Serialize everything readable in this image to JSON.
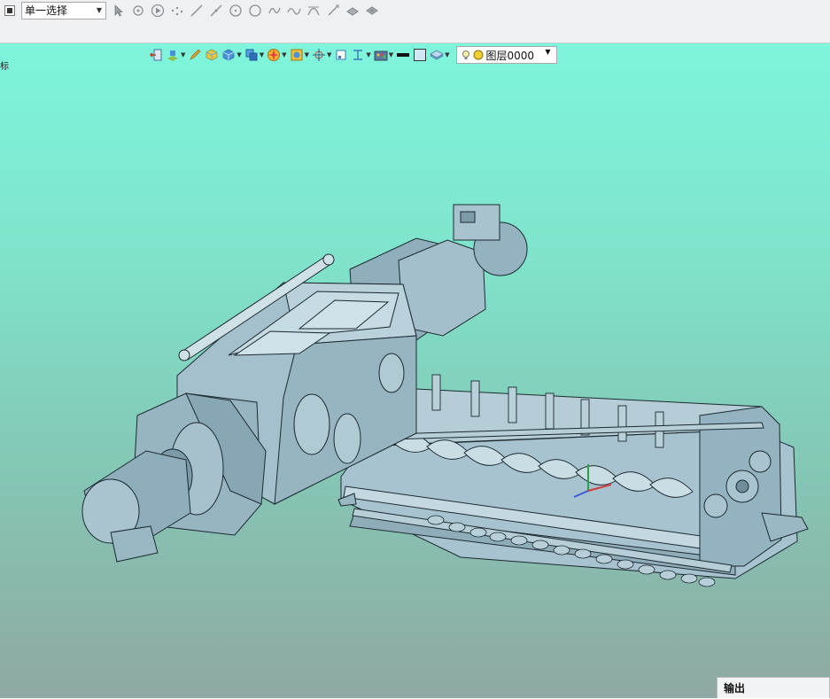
{
  "selection": {
    "mode": "单一选择"
  },
  "layer": {
    "name": "图层0000"
  },
  "viewport": {
    "edge_glyph": "标"
  },
  "output_panel": {
    "title": "输出"
  },
  "colors": {
    "bg_top": "#7ef5dc",
    "bg_bottom": "#8fa8a3",
    "part": "#9fbcc8",
    "edge": "#1c2a30"
  },
  "snap_tools": [
    "pointer-icon",
    "snap-icon",
    "play-icon",
    "point-icon",
    "line-icon",
    "line-icon",
    "circle-center-icon",
    "circle-icon",
    "curve-icon",
    "spline-icon",
    "arc-icon",
    "project-icon",
    "face-icon",
    "face2-icon"
  ],
  "view_tools": [
    "exit-view-icon",
    "view-orient-icon",
    "pencil-icon",
    "box-icon",
    "cube-icon",
    "shade-icon",
    "render-icon",
    "appearance-icon",
    "axis-icon",
    "frame-icon",
    "dimension-icon",
    "color-icon",
    "line-style-icon",
    "fill-icon",
    "layer-tool-icon"
  ]
}
